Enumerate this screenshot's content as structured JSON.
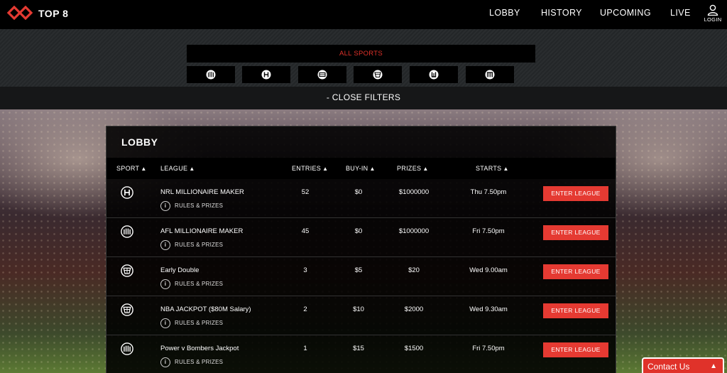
{
  "brand": {
    "name": "TOP 8",
    "accent": "#e53a32"
  },
  "nav": {
    "lobby": "LOBBY",
    "history": "HISTORY",
    "upcoming": "UPCOMING",
    "live": "LIVE",
    "login": "LOGIN"
  },
  "filters": {
    "all_sports": "ALL SPORTS",
    "sports": [
      {
        "icon": "afl-icon"
      },
      {
        "icon": "nrl-icon"
      },
      {
        "icon": "soccer-icon"
      },
      {
        "icon": "basketball-icon"
      },
      {
        "icon": "union-icon"
      },
      {
        "icon": "cricket-icon"
      }
    ],
    "close_label": "- CLOSE FILTERS"
  },
  "lobby": {
    "title": "LOBBY",
    "columns": {
      "sport": "SPORT",
      "league": "LEAGUE",
      "entries": "ENTRIES",
      "buyin": "BUY-IN",
      "prizes": "PRIZES",
      "starts": "STARTS"
    },
    "rules_label": "RULES & PRIZES",
    "enter_label": "ENTER LEAGUE",
    "rows": [
      {
        "icon": "nrl-icon",
        "league": "NRL MILLIONAIRE MAKER",
        "entries": "52",
        "buyin": "$0",
        "prizes": "$1000000",
        "starts": "Thu 7.50pm"
      },
      {
        "icon": "afl-icon",
        "league": "AFL MILLIONAIRE MAKER",
        "entries": "45",
        "buyin": "$0",
        "prizes": "$1000000",
        "starts": "Fri 7.50pm"
      },
      {
        "icon": "basketball-icon",
        "league": "Early Double",
        "entries": "3",
        "buyin": "$5",
        "prizes": "$20",
        "starts": "Wed 9.00am"
      },
      {
        "icon": "basketball-icon",
        "league": "NBA JACKPOT ($80M Salary)",
        "entries": "2",
        "buyin": "$10",
        "prizes": "$2000",
        "starts": "Wed 9.30am"
      },
      {
        "icon": "afl-icon",
        "league": "Power v Bombers Jackpot",
        "entries": "1",
        "buyin": "$15",
        "prizes": "$1500",
        "starts": "Fri 7.50pm"
      }
    ]
  },
  "contact": {
    "label": "Contact Us"
  }
}
